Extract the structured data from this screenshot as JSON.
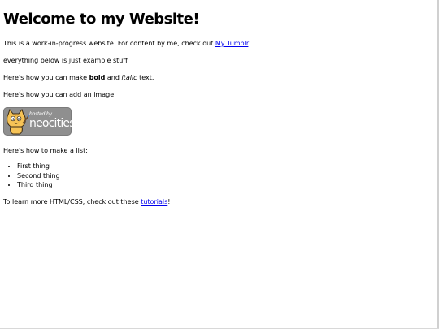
{
  "heading": "Welcome to my Website!",
  "intro": {
    "text": "This is a work-in-progress website. For content by me, check out ",
    "link": "My Tumblr",
    "after": "."
  },
  "example_note": "everything below is just example stuff",
  "bold_line": {
    "before": "Here's how you can make ",
    "bold": "bold",
    "middle": " and ",
    "italic": "italic",
    "after": " text."
  },
  "image_line": "Here's how you can add an image:",
  "badge": {
    "small_text": "hosted by",
    "big_text": "neocities",
    "icon": "neocities-cat-icon"
  },
  "list_line": "Here's how to make a list:",
  "list_items": [
    "First thing",
    "Second thing",
    "Third thing"
  ],
  "learn": {
    "before": "To learn more HTML/CSS, check out these ",
    "link": "tutorials",
    "after": "!"
  },
  "colors": {
    "link": "#0000ee",
    "badge_bg": "#8f8f8f"
  }
}
